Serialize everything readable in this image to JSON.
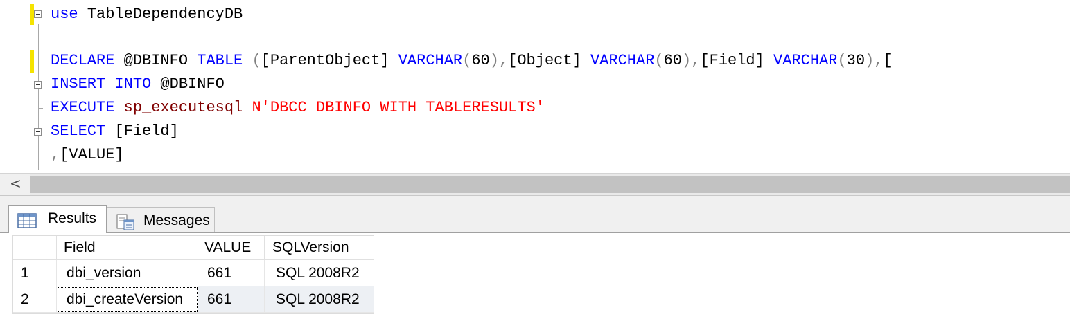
{
  "editor": {
    "lines": [
      [
        {
          "t": "use",
          "c": "kw"
        },
        {
          "t": " TableDependencyDB",
          "c": ""
        }
      ],
      [],
      [
        {
          "t": "DECLARE",
          "c": "kw"
        },
        {
          "t": " @DBINFO ",
          "c": ""
        },
        {
          "t": "TABLE",
          "c": "kw"
        },
        {
          "t": " ",
          "c": ""
        },
        {
          "t": "(",
          "c": "gr"
        },
        {
          "t": "[ParentObject] ",
          "c": ""
        },
        {
          "t": "VARCHAR",
          "c": "kw"
        },
        {
          "t": "(",
          "c": "gr"
        },
        {
          "t": "60",
          "c": ""
        },
        {
          "t": "),",
          "c": "gr"
        },
        {
          "t": "[Object] ",
          "c": ""
        },
        {
          "t": "VARCHAR",
          "c": "kw"
        },
        {
          "t": "(",
          "c": "gr"
        },
        {
          "t": "60",
          "c": ""
        },
        {
          "t": "),",
          "c": "gr"
        },
        {
          "t": "[Field] ",
          "c": ""
        },
        {
          "t": "VARCHAR",
          "c": "kw"
        },
        {
          "t": "(",
          "c": "gr"
        },
        {
          "t": "30",
          "c": ""
        },
        {
          "t": "),",
          "c": "gr"
        },
        {
          "t": "[",
          "c": ""
        }
      ],
      [
        {
          "t": "INSERT",
          "c": "kw"
        },
        {
          "t": " ",
          "c": ""
        },
        {
          "t": "INTO",
          "c": "kw"
        },
        {
          "t": " @DBINFO",
          "c": ""
        }
      ],
      [
        {
          "t": "EXECUTE",
          "c": "kw"
        },
        {
          "t": " ",
          "c": ""
        },
        {
          "t": "sp_executesql",
          "c": "fn"
        },
        {
          "t": " ",
          "c": ""
        },
        {
          "t": "N'DBCC DBINFO WITH TABLERESULTS'",
          "c": "str"
        }
      ],
      [
        {
          "t": "SELECT",
          "c": "kw"
        },
        {
          "t": " [Field]",
          "c": ""
        }
      ],
      [
        {
          "t": ",",
          "c": "gr"
        },
        {
          "t": "[VALUE]",
          "c": ""
        }
      ]
    ]
  },
  "scrollbar": {
    "left_arrow": "<"
  },
  "tabs": {
    "results": {
      "label": "Results",
      "icon": "grid-icon"
    },
    "messages": {
      "label": "Messages",
      "icon": "messages-icon"
    }
  },
  "grid": {
    "columns": [
      "",
      "Field",
      "VALUE",
      "SQLVersion"
    ],
    "rows": [
      {
        "num": "1",
        "field": "dbi_version",
        "value": "661",
        "sqlversion": "SQL 2008R2"
      },
      {
        "num": "2",
        "field": "dbi_createVersion",
        "value": "661",
        "sqlversion": "SQL 2008R2"
      }
    ]
  },
  "colors": {
    "keyword": "#0000ff",
    "string": "#ff0000",
    "function": "#800000",
    "change_marker": "#f5e300"
  }
}
